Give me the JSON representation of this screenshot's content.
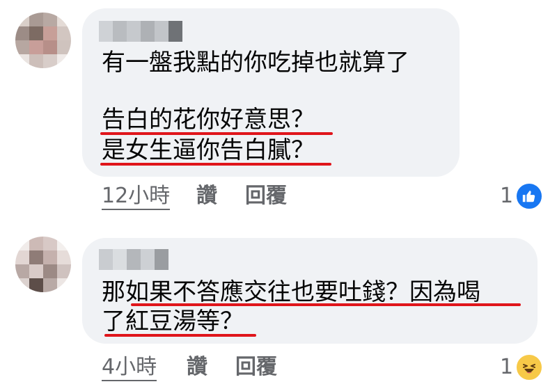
{
  "comments": [
    {
      "lines": [
        "有一盤我點的你吃掉也就算了",
        "告白的花你好意思？",
        "是女生逼你告白膩？"
      ],
      "time": "12小時",
      "like_label": "讚",
      "reply_label": "回覆",
      "reaction_count": "1",
      "reaction_icon": "like-icon"
    },
    {
      "lines": [
        "那如果不答應交往也要吐錢？因為喝",
        "了紅豆湯等？"
      ],
      "time": "4小時",
      "like_label": "讚",
      "reply_label": "回覆",
      "reaction_count": "1",
      "reaction_icon": "haha-icon"
    }
  ],
  "colors": {
    "bubble_bg": "#f0f2f5",
    "highlight_underline": "#e0151b",
    "like_blue": "#1877f2",
    "haha_yellow": "#f7c948",
    "meta_gray": "#65676b"
  }
}
